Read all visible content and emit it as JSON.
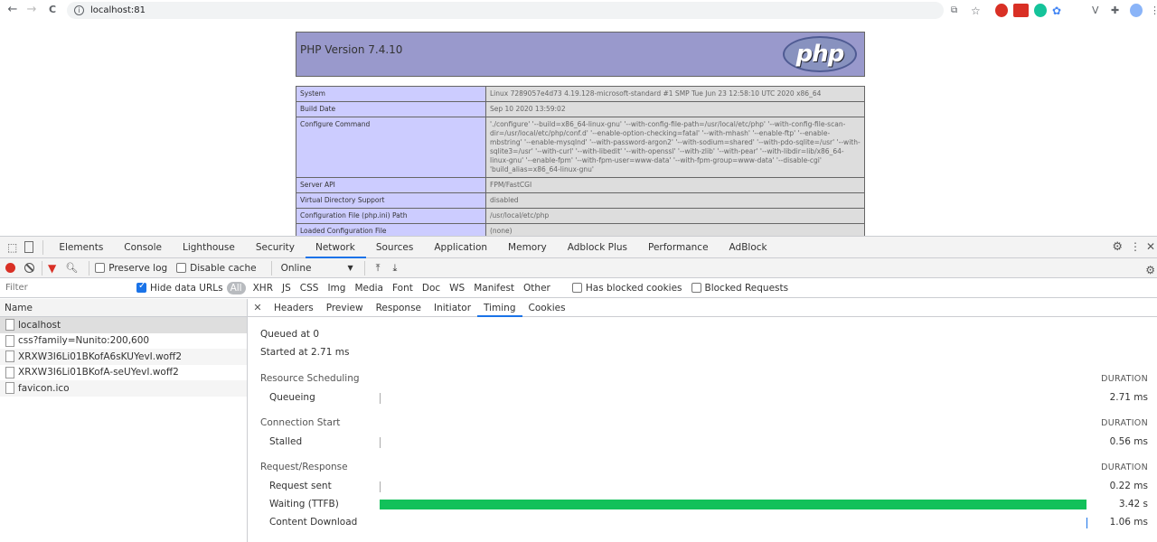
{
  "browser": {
    "url": "localhost:81",
    "back": "←",
    "forward": "→",
    "reload": "C"
  },
  "php": {
    "version_title": "PHP Version 7.4.10",
    "logo_text": "php",
    "rows": [
      {
        "key": "System",
        "value": "Linux 7289057e4d73 4.19.128-microsoft-standard #1 SMP Tue Jun 23 12:58:10 UTC 2020 x86_64"
      },
      {
        "key": "Build Date",
        "value": "Sep 10 2020 13:59:02"
      },
      {
        "key": "Configure Command",
        "value": "'./configure' '--build=x86_64-linux-gnu' '--with-config-file-path=/usr/local/etc/php' '--with-config-file-scan-dir=/usr/local/etc/php/conf.d' '--enable-option-checking=fatal' '--with-mhash' '--enable-ftp' '--enable-mbstring' '--enable-mysqlnd' '--with-password-argon2' '--with-sodium=shared' '--with-pdo-sqlite=/usr' '--with-sqlite3=/usr' '--with-curl' '--with-libedit' '--with-openssl' '--with-zlib' '--with-pear' '--with-libdir=lib/x86_64-linux-gnu' '--enable-fpm' '--with-fpm-user=www-data' '--with-fpm-group=www-data' '--disable-cgi' 'build_alias=x86_64-linux-gnu'"
      },
      {
        "key": "Server API",
        "value": "FPM/FastCGI"
      },
      {
        "key": "Virtual Directory Support",
        "value": "disabled"
      },
      {
        "key": "Configuration File (php.ini) Path",
        "value": "/usr/local/etc/php"
      },
      {
        "key": "Loaded Configuration File",
        "value": "(none)"
      }
    ]
  },
  "devtools": {
    "tabs": [
      "Elements",
      "Console",
      "Lighthouse",
      "Security",
      "Network",
      "Sources",
      "Application",
      "Memory",
      "Adblock Plus",
      "Performance",
      "AdBlock"
    ],
    "active_tab": "Network",
    "toolbar": {
      "preserve_log": "Preserve log",
      "disable_cache": "Disable cache",
      "throttling": "Online"
    },
    "filter": {
      "placeholder": "Filter",
      "hide_data_urls": "Hide data URLs",
      "types": [
        "All",
        "XHR",
        "JS",
        "CSS",
        "Img",
        "Media",
        "Font",
        "Doc",
        "WS",
        "Manifest",
        "Other"
      ],
      "has_blocked_cookies": "Has blocked cookies",
      "blocked_requests": "Blocked Requests"
    },
    "request_list": {
      "header": "Name",
      "items": [
        "localhost",
        "css?family=Nunito:200,600",
        "XRXW3I6Li01BKofA6sKUYevI.woff2",
        "XRXW3I6Li01BKofA-seUYevI.woff2",
        "favicon.ico"
      ]
    },
    "detail_tabs": [
      "Headers",
      "Preview",
      "Response",
      "Initiator",
      "Timing",
      "Cookies"
    ],
    "active_detail_tab": "Timing",
    "timing": {
      "queued_at": "Queued at 0",
      "started_at": "Started at 2.71 ms",
      "duration_label": "DURATION",
      "sections": [
        {
          "title": "Resource Scheduling",
          "phases": [
            {
              "name": "Queueing",
              "duration": "2.71 ms"
            }
          ]
        },
        {
          "title": "Connection Start",
          "phases": [
            {
              "name": "Stalled",
              "duration": "0.56 ms"
            }
          ]
        },
        {
          "title": "Request/Response",
          "phases": [
            {
              "name": "Request sent",
              "duration": "0.22 ms"
            },
            {
              "name": "Waiting (TTFB)",
              "duration": "3.42 s"
            },
            {
              "name": "Content Download",
              "duration": "1.06 ms"
            }
          ]
        }
      ],
      "colors": {
        "waiting": "#12c15a",
        "download": "#1a73e8"
      }
    }
  }
}
